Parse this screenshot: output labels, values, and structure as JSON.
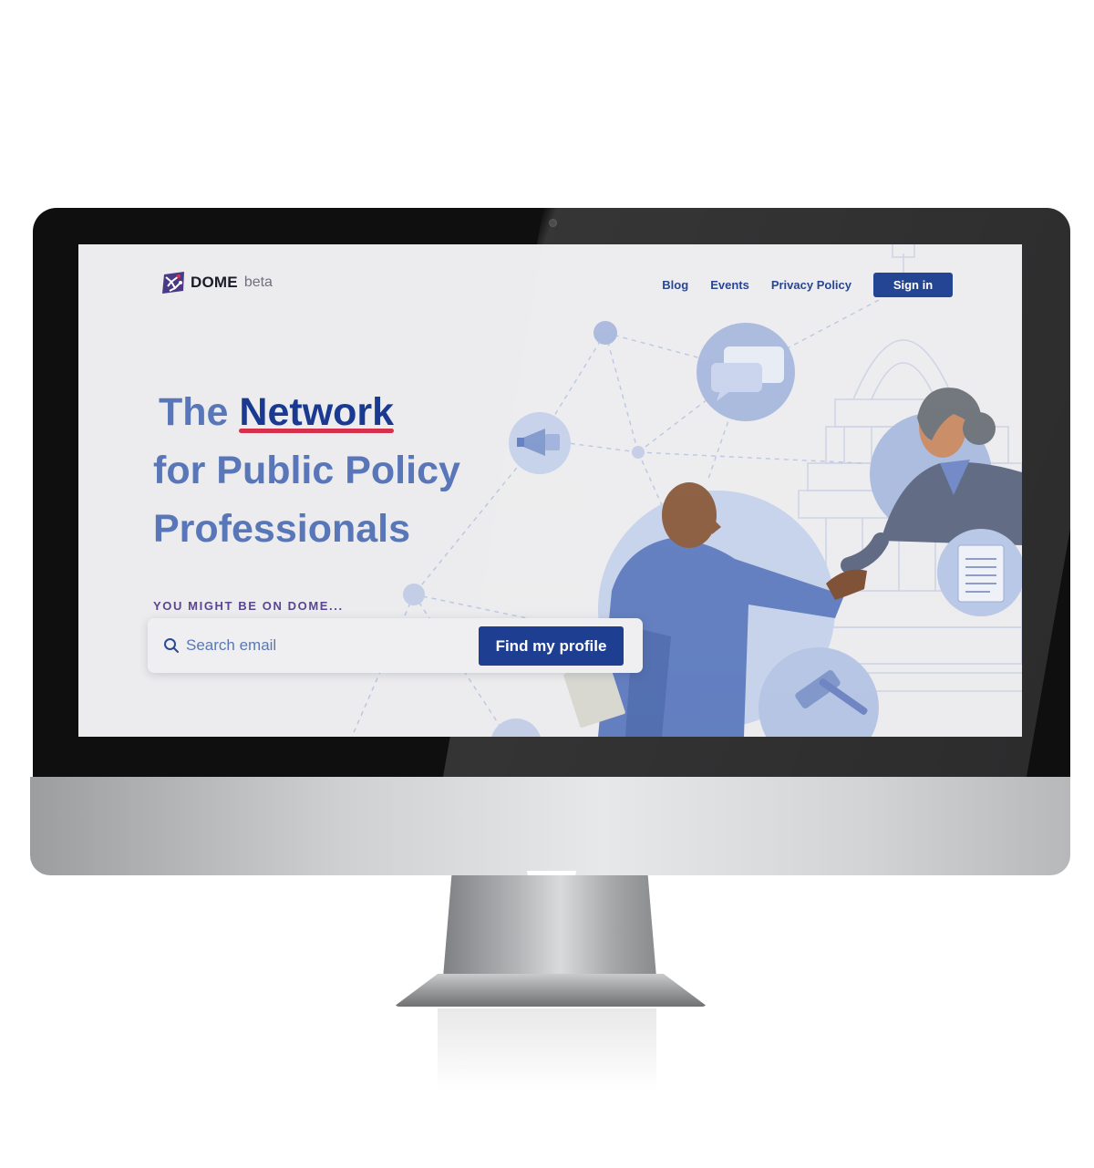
{
  "brand": {
    "name": "DOME",
    "tag": "beta"
  },
  "nav": {
    "links": [
      "Blog",
      "Events",
      "Privacy Policy"
    ],
    "signin_label": "Sign in"
  },
  "hero": {
    "line1_prefix": "The",
    "line1_accent": "Network",
    "line2": "for Public Policy",
    "line3": "Professionals"
  },
  "search": {
    "kicker": "YOU MIGHT BE ON DOME...",
    "placeholder": "Search email",
    "button_label": "Find my profile"
  },
  "colors": {
    "primary": "#17398e",
    "hero_text": "#5876b8",
    "accent_underline": "#d6314c",
    "kicker": "#5a4590",
    "screen_bg": "#ececee"
  },
  "icons": [
    "search-icon",
    "megaphone-icon",
    "chat-bubble-icon",
    "document-icon",
    "gavel-icon"
  ]
}
